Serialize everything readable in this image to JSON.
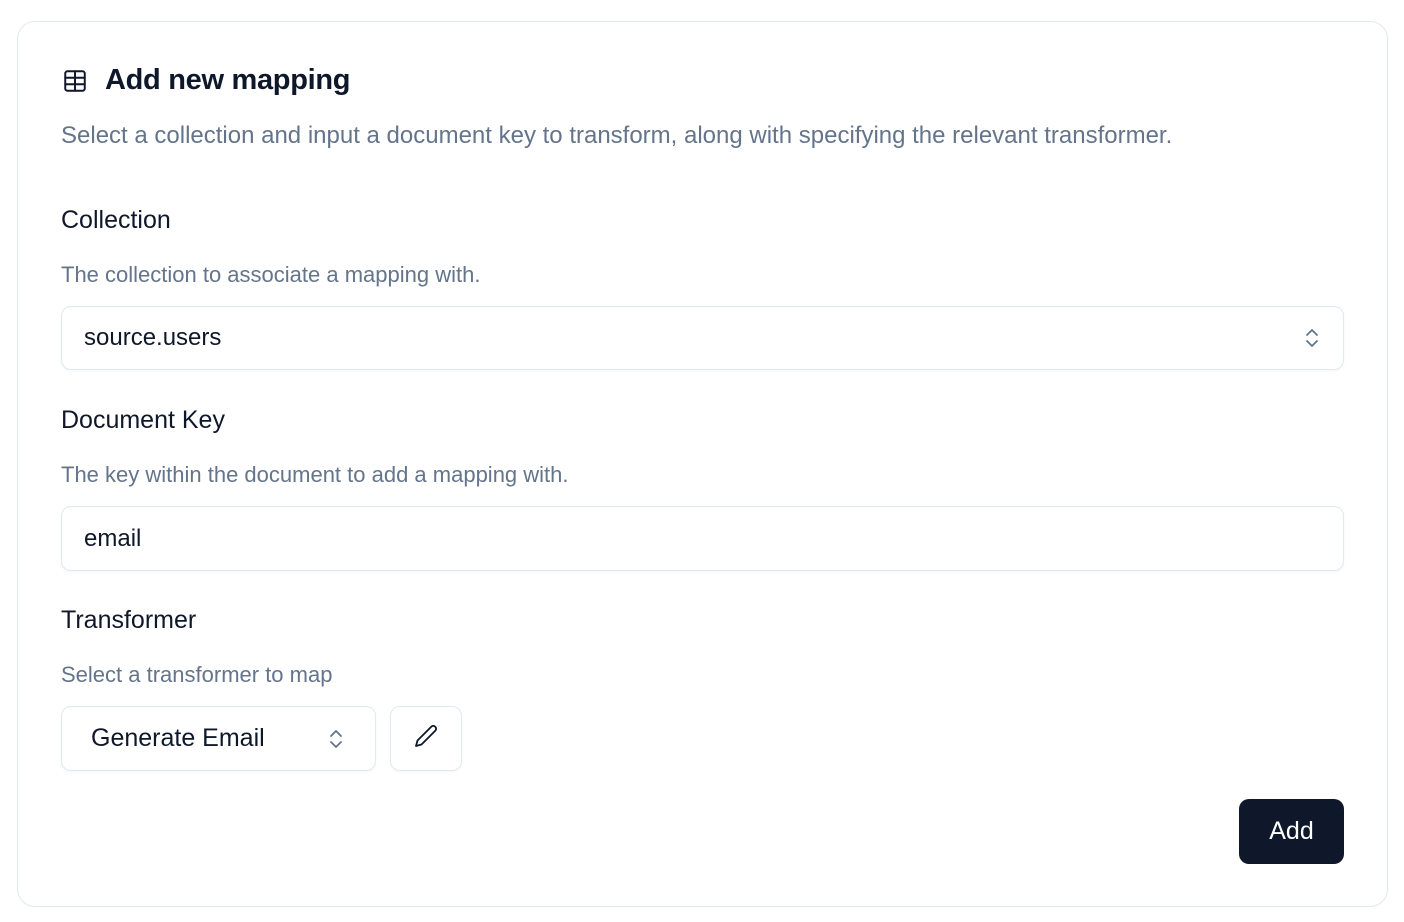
{
  "card": {
    "title": "Add new mapping",
    "subtitle": "Select a collection and input a document key to transform, along with specifying the relevant transformer.",
    "title_icon": "table-icon"
  },
  "collection": {
    "label": "Collection",
    "description": "The collection to associate a mapping with.",
    "value": "source.users",
    "icon": "chevron-up-down-icon"
  },
  "document_key": {
    "label": "Document Key",
    "description": "The key within the document to add a mapping with.",
    "value": "email"
  },
  "transformer": {
    "label": "Transformer",
    "description": "Select a transformer to map",
    "value": "Generate Email",
    "icon": "chevron-up-down-icon",
    "edit_icon": "pencil-icon"
  },
  "actions": {
    "add_label": "Add"
  },
  "colors": {
    "primary": "#0f172a",
    "muted_text": "#64748b",
    "border": "#e2e8f0"
  }
}
